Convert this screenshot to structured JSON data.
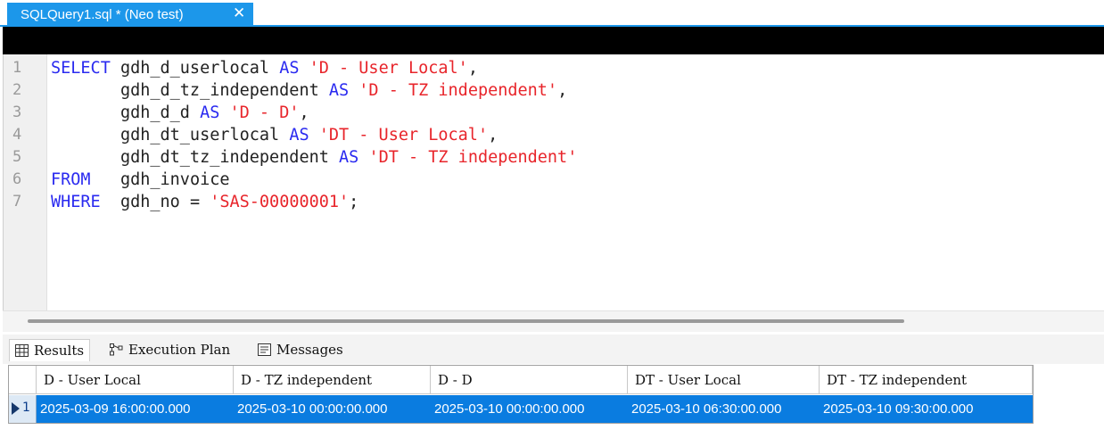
{
  "tab": {
    "title": "SQLQuery1.sql * (Neo test)",
    "close": "✕"
  },
  "editor": {
    "line_numbers": [
      "1",
      "2",
      "3",
      "4",
      "5",
      "6",
      "7"
    ],
    "lines": [
      [
        {
          "t": "SELECT",
          "k": "kw"
        },
        {
          "t": " gdh_d_userlocal ",
          "k": "id"
        },
        {
          "t": "AS",
          "k": "kw"
        },
        {
          "t": " ",
          "k": "id"
        },
        {
          "t": "'D - User Local'",
          "k": "str"
        },
        {
          "t": ",",
          "k": "id"
        }
      ],
      [
        {
          "t": "       gdh_d_tz_independent ",
          "k": "id"
        },
        {
          "t": "AS",
          "k": "kw"
        },
        {
          "t": " ",
          "k": "id"
        },
        {
          "t": "'D - TZ independent'",
          "k": "str"
        },
        {
          "t": ",",
          "k": "id"
        }
      ],
      [
        {
          "t": "       gdh_d_d ",
          "k": "id"
        },
        {
          "t": "AS",
          "k": "kw"
        },
        {
          "t": " ",
          "k": "id"
        },
        {
          "t": "'D - D'",
          "k": "str"
        },
        {
          "t": ",",
          "k": "id"
        }
      ],
      [
        {
          "t": "       gdh_dt_userlocal ",
          "k": "id"
        },
        {
          "t": "AS",
          "k": "kw"
        },
        {
          "t": " ",
          "k": "id"
        },
        {
          "t": "'DT - User Local'",
          "k": "str"
        },
        {
          "t": ",",
          "k": "id"
        }
      ],
      [
        {
          "t": "       gdh_dt_tz_independent ",
          "k": "id"
        },
        {
          "t": "AS",
          "k": "kw"
        },
        {
          "t": " ",
          "k": "id"
        },
        {
          "t": "'DT - TZ independent'",
          "k": "str"
        }
      ],
      [
        {
          "t": "FROM",
          "k": "kw"
        },
        {
          "t": "   gdh_invoice",
          "k": "id"
        }
      ],
      [
        {
          "t": "WHERE",
          "k": "kw"
        },
        {
          "t": "  gdh_no = ",
          "k": "id"
        },
        {
          "t": "'SAS-00000001'",
          "k": "str"
        },
        {
          "t": ";",
          "k": "id"
        }
      ]
    ]
  },
  "results_tabs": [
    {
      "label": "Results",
      "icon": "grid-icon"
    },
    {
      "label": "Execution Plan",
      "icon": "execution-plan-icon"
    },
    {
      "label": "Messages",
      "icon": "messages-icon"
    }
  ],
  "grid": {
    "columns": [
      "D - User Local",
      "D - TZ independent",
      "D - D",
      "DT - User Local",
      "DT - TZ independent"
    ],
    "rows": [
      {
        "num": "1",
        "cells": [
          "2025-03-09 16:00:00.000",
          "2025-03-10 00:00:00.000",
          "2025-03-10 00:00:00.000",
          "2025-03-10 06:30:00.000",
          "2025-03-10 09:30:00.000"
        ]
      }
    ]
  },
  "colors": {
    "accent": "#1c97ea",
    "keyword": "#2a2af0",
    "string": "#e8252b",
    "selection": "#0a7ce0"
  }
}
